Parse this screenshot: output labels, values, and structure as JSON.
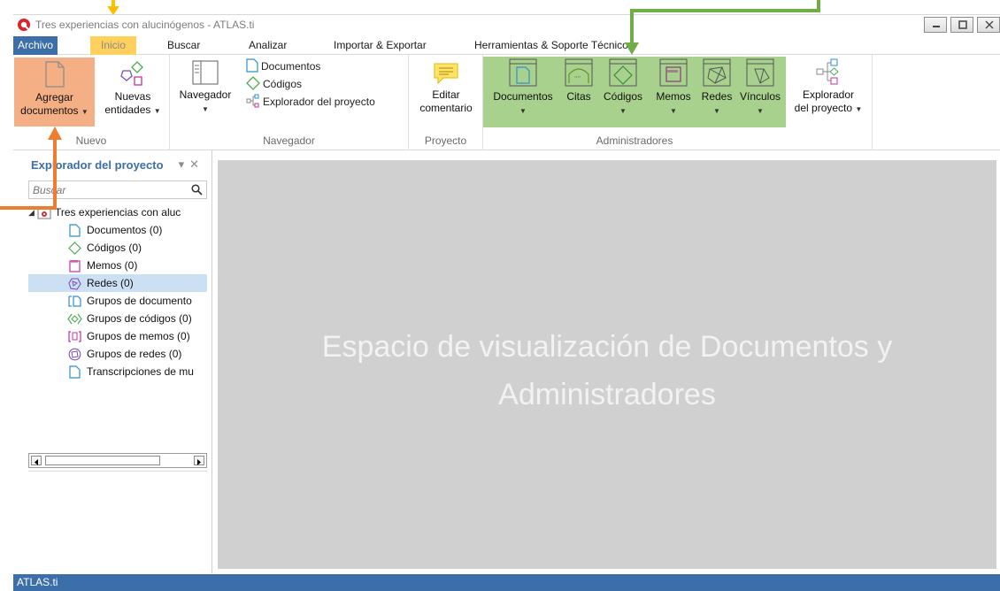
{
  "window": {
    "title": "Tres experiencias con alucinógenos - ATLAS.ti",
    "controls": [
      "minimize-icon",
      "maximize-icon",
      "close-icon"
    ]
  },
  "menu": {
    "items": [
      "Archivo",
      "Inicio",
      "Buscar",
      "Analizar",
      "Importar & Exportar",
      "Herramientas & Soporte Técnico"
    ],
    "active": "Inicio"
  },
  "ribbon": {
    "nuevo": {
      "label": "Nuevo",
      "agregar_1": "Agregar",
      "agregar_2": "documentos",
      "nuevas_1": "Nuevas",
      "nuevas_2": "entidades"
    },
    "navegador": {
      "label": "Navegador",
      "button": "Navegador",
      "documentos": "Documentos",
      "codigos": "Códigos",
      "explorador": "Explorador del proyecto"
    },
    "proyecto": {
      "label": "Proyecto",
      "editar_1": "Editar",
      "editar_2": "comentario"
    },
    "administradores": {
      "label": "Administradores",
      "documentos": "Documentos",
      "citas": "Citas",
      "codigos": "Códigos",
      "memos": "Memos",
      "redes": "Redes",
      "vinculos": "Vínculos",
      "explorador_1": "Explorador",
      "explorador_2": "del proyecto"
    }
  },
  "panel": {
    "title": "Explorador del proyecto",
    "search_placeholder": "Buscar",
    "root": "Tres experiencias con aluc",
    "items": [
      "Documentos (0)",
      "Códigos (0)",
      "Memos (0)",
      "Redes (0)",
      "Grupos de documento",
      "Grupos de códigos (0)",
      "Grupos de memos (0)",
      "Grupos de redes (0)",
      "Transcripciones de mu"
    ],
    "selected": "Redes (0)"
  },
  "main": {
    "line1": "Espacio de visualización de Documentos y",
    "line2": "Administradores"
  },
  "status": {
    "text": "ATLAS.ti"
  },
  "colors": {
    "accent_blue": "#3c6ea9",
    "highlight_yellow": "#ffd15c",
    "highlight_orange": "#f4b084",
    "highlight_green": "#a9d18e",
    "arrow_orange": "#ed7d31",
    "arrow_green": "#70ad47",
    "arrow_yellow": "#ffc000"
  }
}
